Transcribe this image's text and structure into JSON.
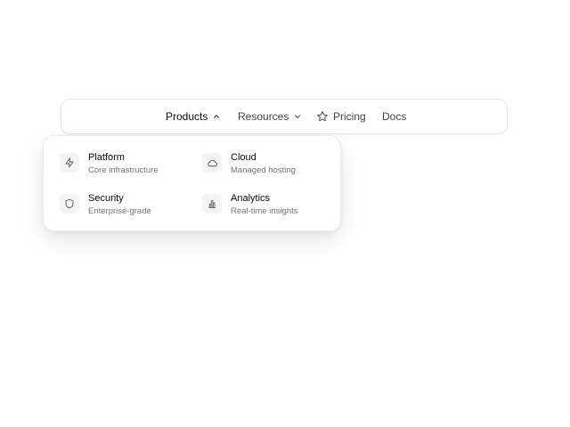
{
  "nav": {
    "items": [
      {
        "label": "Products",
        "icon": "chevron-up-icon"
      },
      {
        "label": "Resources",
        "icon": "chevron-down-icon"
      },
      {
        "label": "Pricing",
        "icon": "star-icon"
      },
      {
        "label": "Docs"
      }
    ]
  },
  "dropdown": {
    "items": [
      {
        "title": "Platform",
        "desc": "Core infrastructure",
        "icon": "lightning-icon"
      },
      {
        "title": "Cloud",
        "desc": "Managed hosting",
        "icon": "cloud-icon"
      },
      {
        "title": "Security",
        "desc": "Enterprise-grade",
        "icon": "shield-icon"
      },
      {
        "title": "Analytics",
        "desc": "Real-time insights",
        "icon": "bar-chart-icon"
      }
    ]
  },
  "colors": {
    "text_primary": "#09090b",
    "text_secondary": "#71717a",
    "border": "#e4e4e7",
    "icon_bg": "#f4f4f5"
  }
}
